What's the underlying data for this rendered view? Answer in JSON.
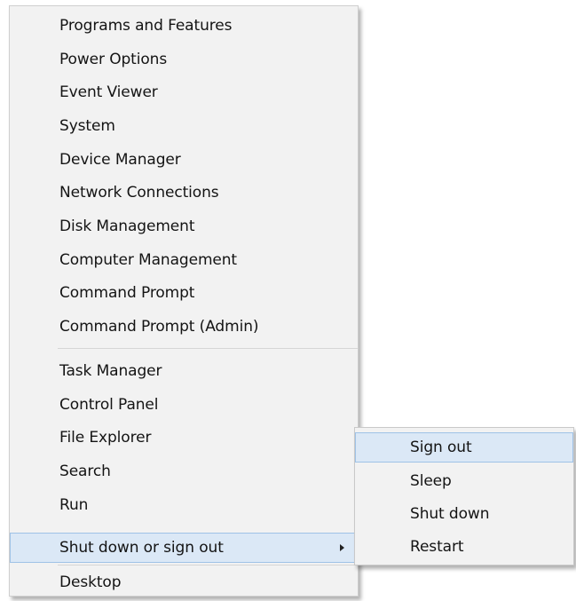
{
  "context_menu": {
    "group1": [
      "Programs and Features",
      "Power Options",
      "Event Viewer",
      "System",
      "Device Manager",
      "Network Connections",
      "Disk Management",
      "Computer Management",
      "Command Prompt",
      "Command Prompt (Admin)"
    ],
    "group2": [
      "Task Manager",
      "Control Panel",
      "File Explorer",
      "Search",
      "Run"
    ],
    "shutdown_item": "Shut down or sign out",
    "desktop_item": "Desktop",
    "highlight_color": "#dbe8f6",
    "highlight_border": "#9fc2e6"
  },
  "submenu": {
    "items": [
      "Sign out",
      "Sleep",
      "Shut down",
      "Restart"
    ]
  }
}
